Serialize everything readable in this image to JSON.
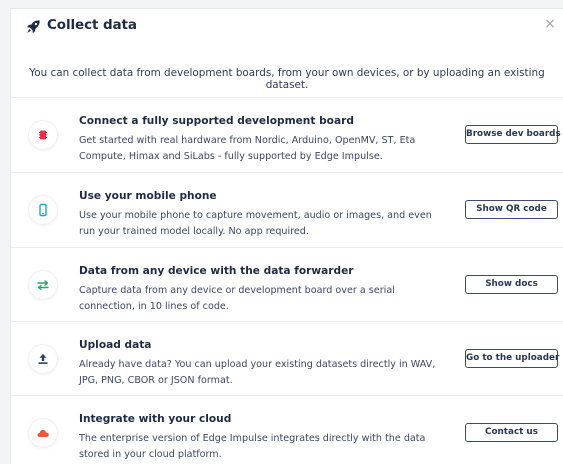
{
  "dialog": {
    "title": "Collect data",
    "close_label": "×",
    "intro": "You can collect data from development boards, from your own devices, or by uploading an existing dataset."
  },
  "options": [
    {
      "title": "Connect a fully supported development board",
      "description": "Get started with real hardware from Nordic, Arduino, OpenMV, ST, Eta Compute, Himax and SiLabs - fully supported by Edge Impulse.",
      "button": "Browse dev boards",
      "icon": "dev-board-icon",
      "icon_color": "#e0324b"
    },
    {
      "title": "Use your mobile phone",
      "description": "Use your mobile phone to capture movement, audio or images, and even run your trained model locally. No app required.",
      "button": "Show QR code",
      "icon": "mobile-phone-icon",
      "icon_color": "#1fa7c4"
    },
    {
      "title": "Data from any device with the data forwarder",
      "description": "Capture data from any device or development board over a serial connection, in 10 lines of code.",
      "button": "Show docs",
      "icon": "data-forwarder-icon",
      "icon_color": "#27a86b"
    },
    {
      "title": "Upload data",
      "description": "Already have data? You can upload your existing datasets directly in WAV, JPG, PNG, CBOR or JSON format.",
      "button": "Go to the uploader",
      "icon": "upload-icon",
      "icon_color": "#2f3f63"
    },
    {
      "title": "Integrate with your cloud",
      "description": "The enterprise version of Edge Impulse integrates directly with the data stored in your cloud platform.",
      "button": "Contact us",
      "icon": "cloud-icon",
      "icon_color": "#e8583a"
    }
  ]
}
